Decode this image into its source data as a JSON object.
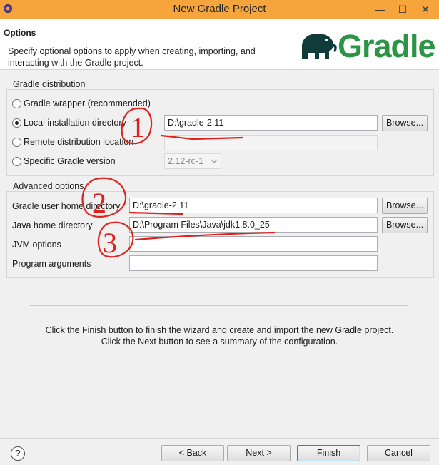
{
  "window": {
    "title": "New Gradle Project",
    "controls": {
      "minimize": "—",
      "maximize": "☐",
      "close": "✕"
    }
  },
  "header": {
    "title": "Options",
    "description": "Specify optional options to apply when creating, importing, and interacting with the Gradle project.",
    "logo_text": "Gradle",
    "logo_color": "#2b9445"
  },
  "distribution": {
    "group_label": "Gradle distribution",
    "options": [
      {
        "label": "Gradle wrapper (recommended)",
        "selected": false
      },
      {
        "label": "Local installation directory",
        "selected": true
      },
      {
        "label": "Remote distribution location",
        "selected": false
      },
      {
        "label": "Specific Gradle version",
        "selected": false
      }
    ],
    "local_dir_value": "D:\\gradle-2.11",
    "remote_value": "",
    "version_value": "2.12-rc-1",
    "browse_label": "Browse..."
  },
  "advanced": {
    "group_label": "Advanced options",
    "fields": [
      {
        "label": "Gradle user home directory",
        "value": "D:\\gradle-2.11",
        "has_browse": true
      },
      {
        "label": "Java home directory",
        "value": "D:\\Program Files\\Java\\jdk1.8.0_25",
        "has_browse": true
      },
      {
        "label": "JVM options",
        "value": "",
        "has_browse": false
      },
      {
        "label": "Program arguments",
        "value": "",
        "has_browse": false
      }
    ],
    "browse_label": "Browse..."
  },
  "info_text": "Click the Finish button to finish the wizard and create and import the new Gradle project. Click the Next button to see a summary of the configuration.",
  "buttons": {
    "help": "?",
    "back": "< Back",
    "next": "Next >",
    "finish": "Finish",
    "cancel": "Cancel"
  },
  "annotations": {
    "marks": [
      "1",
      "2",
      "3"
    ],
    "color": "#e0201c"
  }
}
